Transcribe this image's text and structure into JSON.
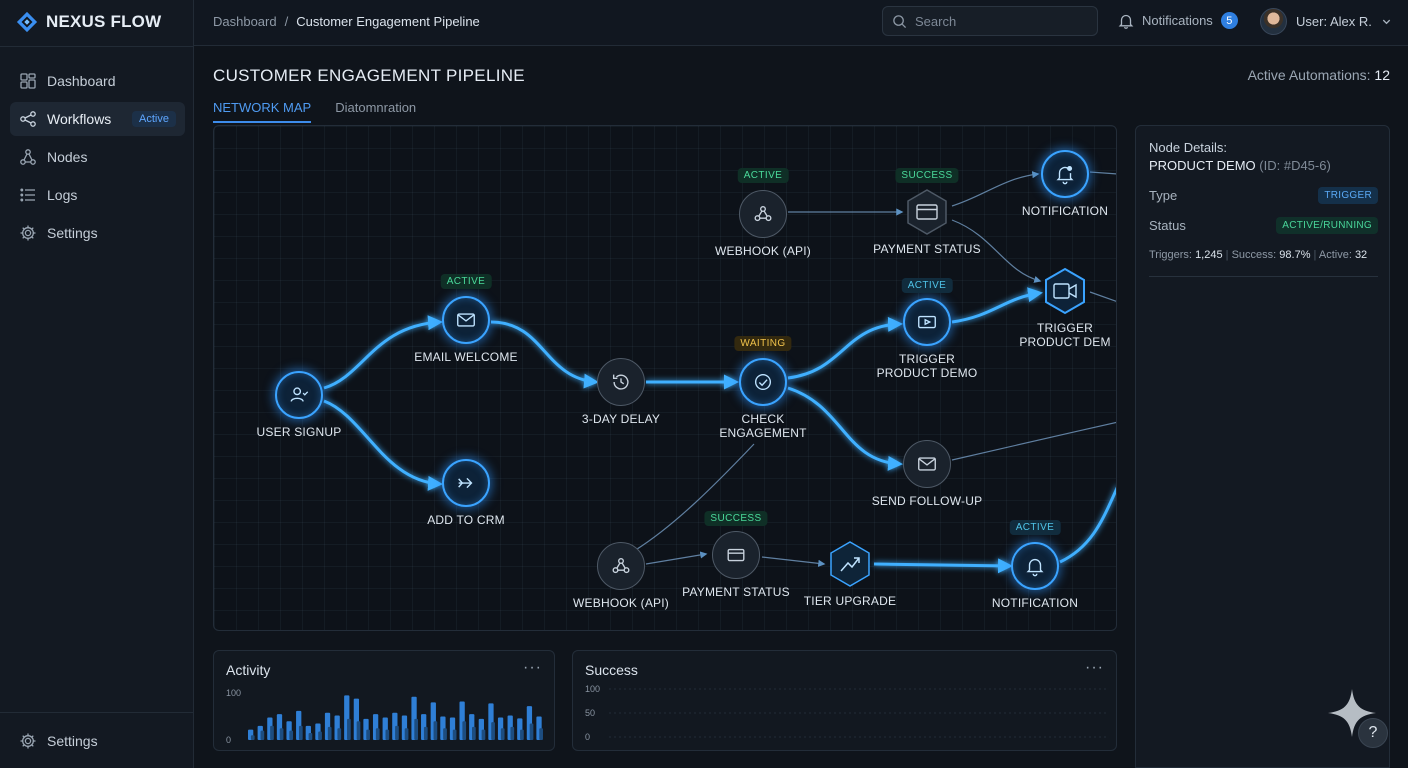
{
  "app": {
    "name": "NEXUS FLOW"
  },
  "sidebar": {
    "items": [
      {
        "label": "Dashboard"
      },
      {
        "label": "Workflows",
        "badge": "Active"
      },
      {
        "label": "Nodes"
      },
      {
        "label": "Logs"
      },
      {
        "label": "Settings"
      }
    ],
    "bottom": {
      "label": "Settings"
    }
  },
  "topbar": {
    "breadcrumb": [
      "Dashboard",
      "/",
      "Customer Engagement Pipeline"
    ],
    "search_placeholder": "Search",
    "notifications_label": "Notifications",
    "notifications_count": "5",
    "user_label": "User: Alex R."
  },
  "page": {
    "title": "CUSTOMER ENGAGEMENT PIPELINE",
    "active_automations_label": "Active Automations:",
    "active_automations_value": "12",
    "tabs": [
      "NETWORK MAP",
      "Diatomnration"
    ]
  },
  "map": {
    "nodes": {
      "user_signup": {
        "label": "USER SIGNUP",
        "icon": "user-check-icon"
      },
      "email_welcome": {
        "label": "EMAIL WELCOME",
        "badge": "ACTIVE",
        "icon": "mail-icon"
      },
      "add_to_crm": {
        "label": "ADD TO CRM",
        "icon": "arrow-right-icon"
      },
      "delay": {
        "label": "3-DAY DELAY",
        "icon": "history-icon"
      },
      "check_engagement": {
        "label": "CHECK",
        "label2": "ENGAGEMENT",
        "badge": "WAITING",
        "icon": "check-circle-icon"
      },
      "webhook_top": {
        "label": "WEBHOOK (API)",
        "badge": "ACTIVE",
        "icon": "webhook-icon"
      },
      "payment_top": {
        "label": "PAYMENT STATUS",
        "badge": "SUCCESS",
        "icon": "card-icon"
      },
      "notification_top": {
        "label": "NOTIFICATION",
        "icon": "bell-icon"
      },
      "trigger_demo_mid": {
        "label": "TRIGGER",
        "label2": "PRODUCT DEMO",
        "badge": "ACTIVE",
        "icon": "video-icon"
      },
      "trigger_demo_right": {
        "label": "TRIGGER",
        "label2": "PRODUCT DEM",
        "icon": "video-icon"
      },
      "send_followup": {
        "label": "SEND FOLLOW-UP",
        "icon": "mail-icon"
      },
      "webhook_bottom": {
        "label": "WEBHOOK (API)",
        "icon": "webhook-icon"
      },
      "payment_bottom": {
        "label": "PAYMENT STATUS",
        "badge": "SUCCESS",
        "icon": "card-icon"
      },
      "tier_upgrade": {
        "label": "TIER UPGRADE",
        "icon": "upgrade-icon"
      },
      "notification_bottom": {
        "label": "NOTIFICATION",
        "badge": "ACTIVE",
        "icon": "bell-icon"
      }
    }
  },
  "panel": {
    "heading": "Node Details:",
    "node_name": "PRODUCT DEMO",
    "node_id": "(ID: #D45-6)",
    "type_label": "Type",
    "type_value": "TRIGGER",
    "status_label": "Status",
    "status_value": "ACTIVE/RUNNING",
    "triggers_label": "Triggers:",
    "triggers_value": "1,245",
    "success_label": "Success:",
    "success_value": "98.7%",
    "active_label": "Active:",
    "active_value": "32"
  },
  "cards": {
    "activity": {
      "title": "Activity",
      "menu": "···"
    },
    "success": {
      "title": "Success",
      "menu": "···"
    }
  },
  "colors": {
    "accent": "#3aa3ff",
    "success": "#4ad99a",
    "warning": "#f0c24b"
  },
  "chart_data": [
    {
      "type": "bar",
      "title": "Activity",
      "ylim": [
        0,
        100
      ],
      "yticks": [
        "100",
        "0"
      ],
      "series": [
        {
          "values": [
            22,
            30,
            48,
            55,
            40,
            62,
            30,
            35,
            58,
            52,
            95,
            88,
            45,
            55,
            48,
            58,
            52,
            92,
            55,
            80,
            50,
            48,
            82,
            55,
            45,
            78,
            48,
            52,
            46,
            72,
            50
          ]
        },
        {
          "values": [
            10,
            20,
            30,
            25,
            20,
            30,
            15,
            18,
            28,
            25,
            45,
            40,
            22,
            25,
            22,
            30,
            25,
            45,
            28,
            40,
            25,
            22,
            40,
            28,
            22,
            38,
            25,
            28,
            22,
            35,
            25
          ]
        }
      ]
    },
    {
      "type": "line",
      "title": "Success",
      "ylim": [
        0,
        100
      ],
      "yticks": [
        "100",
        "50",
        "0"
      ],
      "series": []
    }
  ]
}
